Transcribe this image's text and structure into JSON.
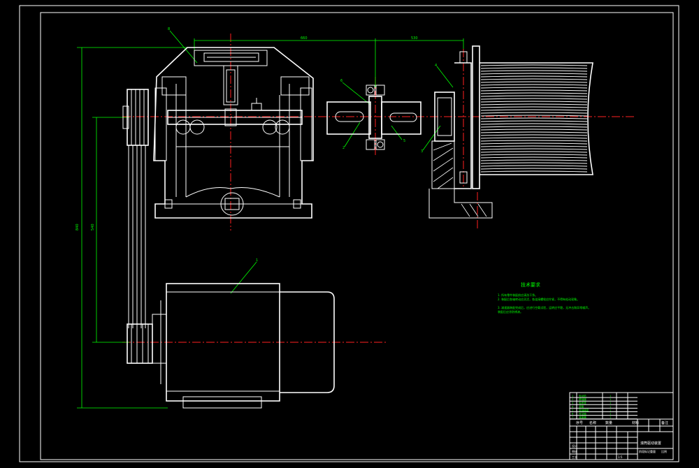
{
  "drawing": {
    "tech_requirements_title": "技术要求",
    "tech_requirements_lines": [
      "1. 所有零件装配前应清洗干净。",
      "2. 装配后各轴转动应灵活，各连接螺栓应拧紧，不得有松动现象。",
      "   ",
      "3. 减速器装配完成后，应进行空载试验，运转应平稳，无冲击和异常噪声。",
      "   装配后应涂防锈漆。"
    ],
    "part_labels": [
      "8",
      "1",
      "2",
      "3",
      "4",
      "5",
      "6",
      "7"
    ],
    "dimensions": [
      "660",
      "530",
      "540",
      "840"
    ]
  },
  "title_block": {
    "header_labels": [
      "序号",
      "名称",
      "数量",
      "材料",
      "备注"
    ],
    "drawing_name": "滚筒驱动装置",
    "rows": [
      [
        "1",
        "电动机",
        "1",
        "",
        ""
      ],
      [
        "2",
        "联轴器",
        "1",
        "",
        ""
      ],
      [
        "3",
        "轴承座",
        "1",
        "",
        ""
      ],
      [
        "4",
        "滚筒",
        "1",
        "",
        ""
      ],
      [
        "5",
        "联轴器套",
        "1",
        "",
        ""
      ],
      [
        "6",
        "传动轴",
        "1",
        "",
        ""
      ],
      [
        "7",
        "减速器",
        "1",
        "",
        ""
      ]
    ],
    "small_labels": [
      "标记",
      "处数",
      "分区",
      "更改文件号",
      "签名",
      "年月日",
      "设计",
      "审核",
      "工艺",
      "批准",
      "阶段标记",
      "重量",
      "比例",
      "共 张",
      "第 张"
    ],
    "scale": "1:5"
  },
  "colors": {
    "background": "#000000",
    "outline": "#ffffff",
    "centerline": "#ff2020",
    "annotation": "#00ff00"
  }
}
